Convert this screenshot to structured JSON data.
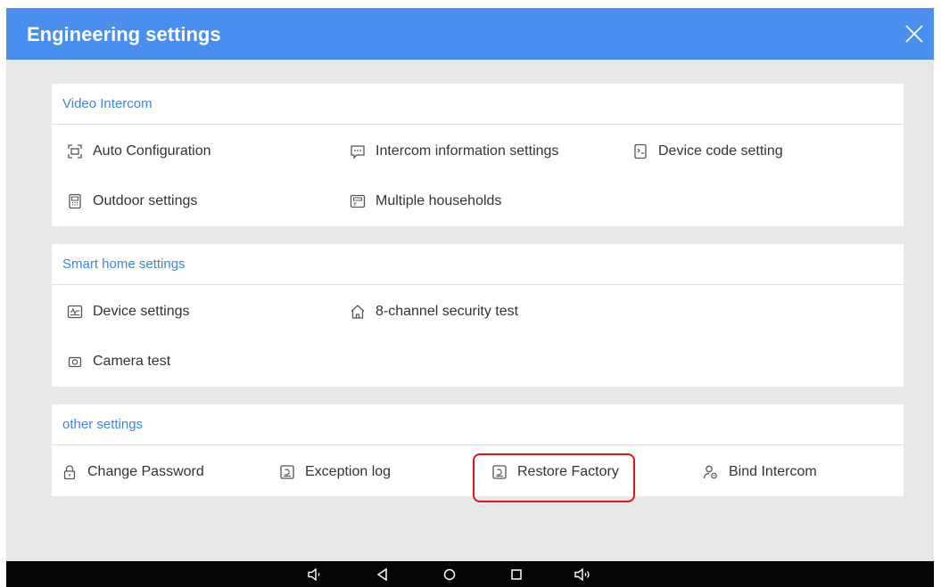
{
  "header": {
    "title": "Engineering settings"
  },
  "sections": [
    {
      "title": "Video Intercom",
      "items": [
        {
          "label": "Auto Configuration",
          "icon": "auto-config-icon"
        },
        {
          "label": "Intercom information settings",
          "icon": "message-icon"
        },
        {
          "label": "Device code setting",
          "icon": "device-code-icon"
        },
        {
          "label": "Outdoor settings",
          "icon": "outdoor-panel-icon"
        },
        {
          "label": "Multiple households",
          "icon": "households-icon"
        }
      ]
    },
    {
      "title": "Smart home settings",
      "items": [
        {
          "label": "Device settings",
          "icon": "device-icon"
        },
        {
          "label": "8-channel security test",
          "icon": "home-icon"
        },
        {
          "label": "Camera test",
          "icon": "camera-icon"
        }
      ]
    },
    {
      "title": "other settings",
      "items": [
        {
          "label": "Change Password",
          "icon": "lock-icon"
        },
        {
          "label": "Exception log",
          "icon": "log-icon"
        },
        {
          "label": "Restore Factory",
          "icon": "restore-icon"
        },
        {
          "label": "Bind Intercom",
          "icon": "bind-user-icon"
        }
      ]
    }
  ],
  "colors": {
    "titlebar": "#4a8ff0",
    "section_title": "#3c86e2",
    "highlight_border": "#e0141c",
    "background": "#e8e8e8",
    "navbar": "#050505"
  },
  "navbar": {
    "buttons": [
      "volume-down-icon",
      "back-icon",
      "home-circle-icon",
      "recents-icon",
      "volume-up-icon"
    ]
  }
}
